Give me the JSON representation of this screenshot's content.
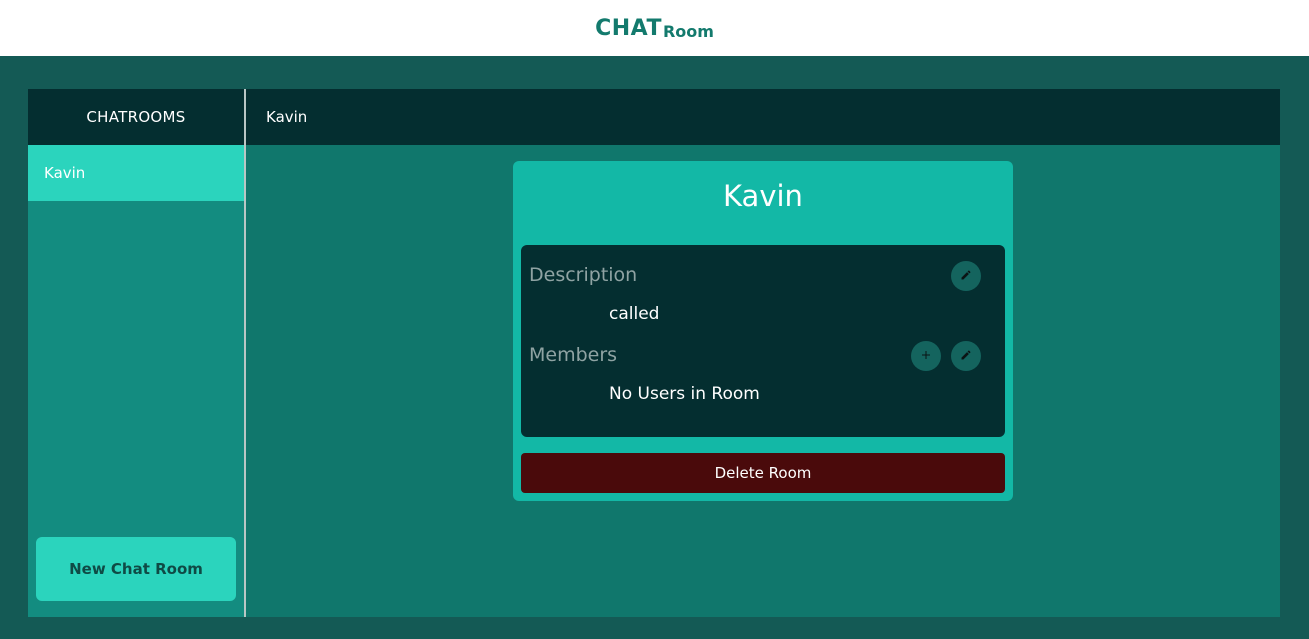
{
  "header": {
    "brand_main": "CHAT",
    "brand_sub": "Room"
  },
  "sidebar": {
    "title": "CHATROOMS",
    "rooms": [
      {
        "label": "Kavin",
        "active": true
      }
    ],
    "new_room_label": "New Chat Room"
  },
  "main": {
    "header_title": "Kavin",
    "card": {
      "title": "Kavin",
      "description_label": "Description",
      "description_value": "called",
      "members_label": "Members",
      "members_value": "No Users in Room",
      "delete_label": "Delete Room"
    },
    "icons": {
      "edit_description": "pencil-icon",
      "add_member": "plus-icon",
      "edit_members": "pencil-icon"
    }
  },
  "colors": {
    "accent": "#2bd4bd",
    "dark_panel": "#042e30",
    "danger": "#4a0a0b",
    "brand_text": "#137a6d"
  }
}
